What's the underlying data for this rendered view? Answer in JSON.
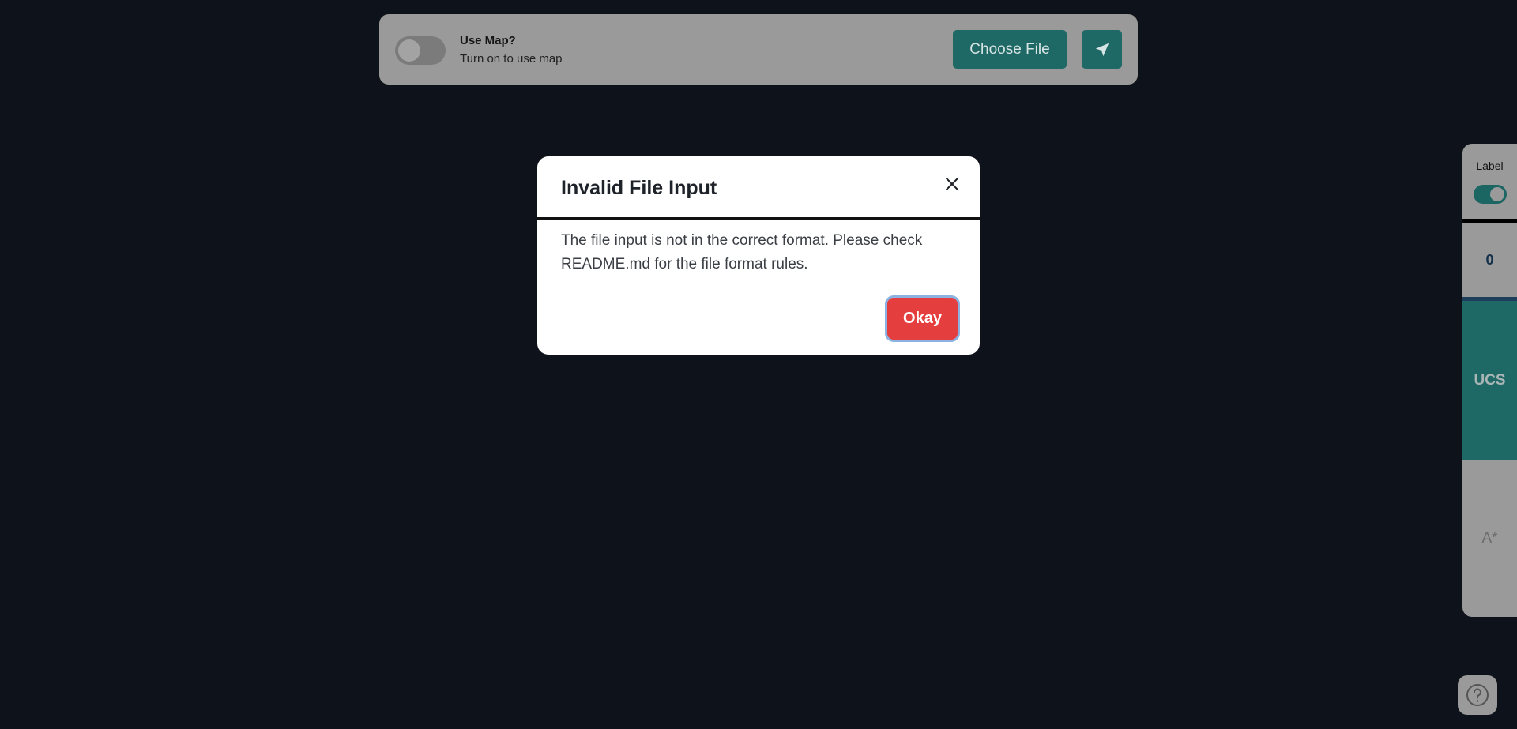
{
  "toolbar": {
    "map_toggle_title": "Use Map?",
    "map_toggle_subtitle": "Turn on to use map",
    "map_toggle_on": false,
    "choose_file_label": "Choose File",
    "locate_icon": "navigation-arrow-icon"
  },
  "side_panel": {
    "label_text": "Label",
    "label_toggle_on": true,
    "count": "0",
    "algorithms": [
      {
        "label": "UCS",
        "selected": true
      },
      {
        "label": "A*",
        "selected": false
      }
    ]
  },
  "help": {
    "icon": "question-icon"
  },
  "modal": {
    "title": "Invalid File Input",
    "body": "The file input is not in the correct format. Please check README.md for the file format rules.",
    "ok_label": "Okay",
    "close_icon": "close-icon"
  },
  "colors": {
    "background": "#0e121a",
    "teal": "#1e6865",
    "danger": "#e53e3e",
    "panel_gray": "#9a9a9a"
  }
}
